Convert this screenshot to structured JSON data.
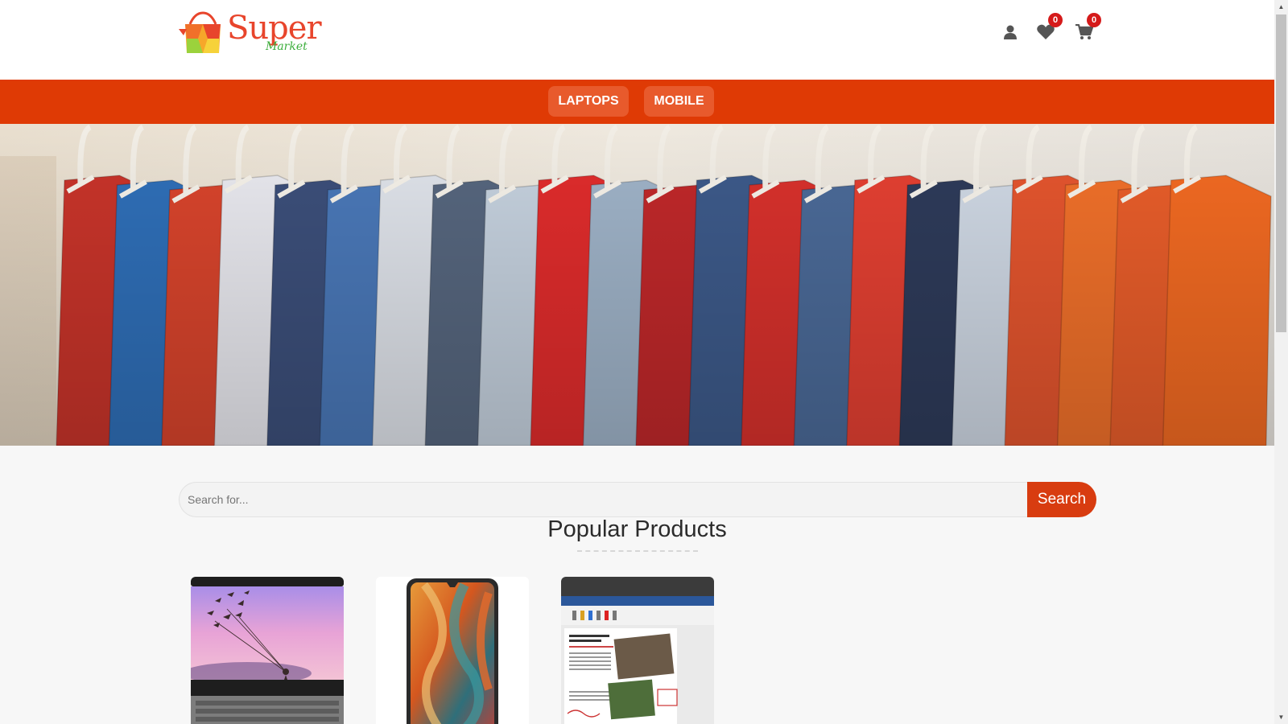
{
  "header": {
    "logo": {
      "word": "Super",
      "sub": "Market"
    },
    "icons": {
      "account": "user-icon",
      "wishlist": {
        "icon": "heart-icon",
        "count": "0"
      },
      "cart": {
        "icon": "cart-icon",
        "count": "0"
      }
    }
  },
  "nav": {
    "items": [
      {
        "label": "LAPTOPS"
      },
      {
        "label": "MOBILE"
      }
    ]
  },
  "banner": {
    "subject": "clothes-rack-photo"
  },
  "search": {
    "placeholder": "Search for...",
    "button_label": "Search"
  },
  "products": {
    "title": "Popular Products",
    "items": [
      {
        "image": "laptop-image"
      },
      {
        "image": "smartphone-image"
      },
      {
        "image": "tablet-document-image"
      }
    ]
  },
  "colors": {
    "brand": "#df3a05",
    "badge": "#d51a1a",
    "search_button": "#d83c10"
  }
}
